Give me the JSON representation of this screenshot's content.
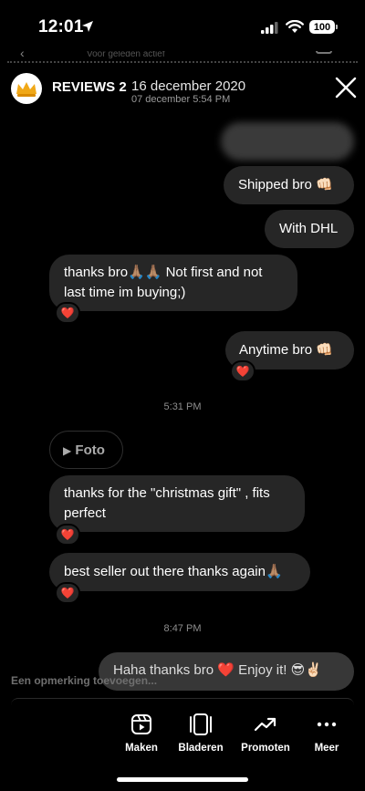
{
  "status_bar": {
    "time": "12:01",
    "battery": "100"
  },
  "behind": {
    "text": "Voor geleden actief"
  },
  "header": {
    "title": "REVIEWS 2",
    "date": "16 december 2020",
    "subtitle": "07 december 5:54 PM"
  },
  "messages": [
    {
      "text": "Shipped bro 👊🏻"
    },
    {
      "text": "With DHL"
    },
    {
      "text": "thanks bro🙏🏽🙏🏽 Not first and not last time im buying;)",
      "reaction": "❤️"
    },
    {
      "text": "Anytime bro 👊🏻",
      "reaction": "❤️"
    },
    {
      "text": "Foto"
    },
    {
      "text": "thanks for the \"christmas gift\" , fits perfect",
      "reaction": "❤️"
    },
    {
      "text": "best seller out there thanks again🙏🏽",
      "reaction": "❤️"
    }
  ],
  "timestamps": [
    "5:31 PM",
    "8:47 PM"
  ],
  "comment": {
    "text": "Haha thanks bro ❤️ Enjoy it! 😎✌🏻",
    "placeholder": "Een opmerking toevoegen..."
  },
  "toolbar": [
    {
      "label": "Maken",
      "icon": "reel-icon"
    },
    {
      "label": "Bladeren",
      "icon": "carousel-icon"
    },
    {
      "label": "Promoten",
      "icon": "trend-up-icon"
    },
    {
      "label": "Meer",
      "icon": "more-icon"
    }
  ],
  "colors": {
    "bubble": "#262626",
    "background": "#000000",
    "muted": "#8e8e8e"
  }
}
